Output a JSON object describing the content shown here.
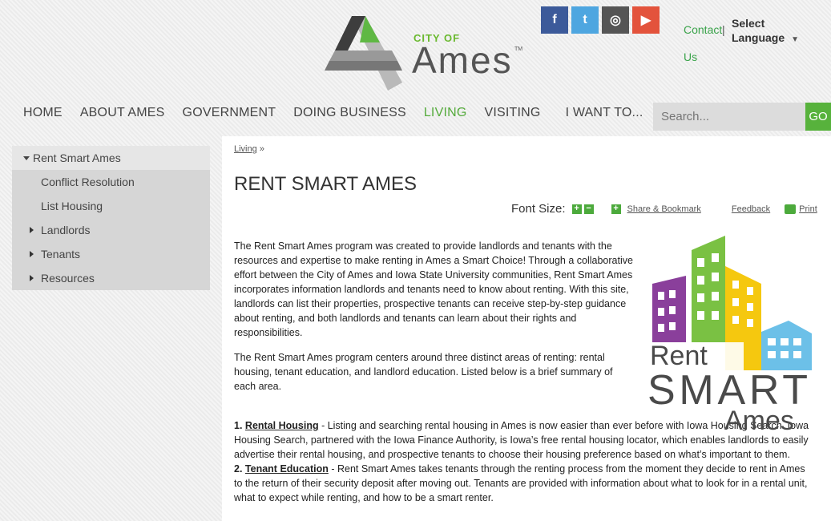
{
  "header": {
    "logo_city_of": "CITY OF",
    "logo_ames": "Ames",
    "logo_tm": "TM",
    "social": [
      {
        "icon": "facebook-icon",
        "glyph": "f",
        "color": "#3c5a9a"
      },
      {
        "icon": "twitter-icon",
        "glyph": "t",
        "color": "#4ea6e0"
      },
      {
        "icon": "instagram-icon",
        "glyph": "◎",
        "color": "#555555"
      },
      {
        "icon": "youtube-icon",
        "glyph": "▶",
        "color": "#e3533c"
      }
    ],
    "contact_label": "Contact Us",
    "contact_sep": "|",
    "language_label": "Select Language"
  },
  "nav": {
    "items": [
      "HOME",
      "ABOUT AMES",
      "GOVERNMENT",
      "DOING BUSINESS",
      "LIVING",
      "VISITING",
      "I WANT TO..."
    ],
    "active": "LIVING",
    "search_placeholder": "Search...",
    "go_label": "GO"
  },
  "sidebar": {
    "top": "Rent Smart Ames",
    "items": [
      {
        "label": "Conflict Resolution",
        "expandable": false
      },
      {
        "label": "List Housing",
        "expandable": false
      },
      {
        "label": "Landlords",
        "expandable": true
      },
      {
        "label": "Tenants",
        "expandable": true
      },
      {
        "label": "Resources",
        "expandable": true
      }
    ]
  },
  "main": {
    "breadcrumb": "Living",
    "breadcrumb_sep": "»",
    "title": "RENT SMART AMES",
    "font_size_label": "Font Size:",
    "share_label": "Share & Bookmark",
    "feedback_label": "Feedback",
    "print_label": "Print",
    "para1": "The Rent Smart Ames program was created to provide landlords and tenants with the resources and expertise to make renting in Ames a Smart Choice! Through a collaborative effort between the City of Ames and Iowa State University communities, Rent Smart Ames incorporates information landlords and tenants need to know about renting. With this site, landlords can list their properties, prospective tenants can receive step-by-step guidance about renting, and both landlords and tenants can learn about their rights and responsibilities.",
    "para2": "The Rent Smart Ames program centers around three distinct areas of renting: rental housing, tenant education, and landlord education. Listed below is a brief summary of each area.",
    "item1_num": "1.",
    "item1_title": "Rental Housing",
    "item1_text": " - Listing and searching rental housing in Ames is now easier than ever before with Iowa Housing Search. Iowa Housing Search, partnered with the Iowa Finance Authority, is Iowa’s free rental housing locator, which enables landlords to easily advertise their rental housing, and prospective tenants to choose their housing preference based on what’s important to them.",
    "item2_num": "2.",
    "item2_title": "Tenant Education",
    "item2_text": " - Rent Smart Ames takes tenants through the renting process from the moment they decide to rent in Ames to the return of their security deposit after moving out. Tenants are provided with information about what to look for in a rental unit, what to expect while renting, and how to be a smart renter.",
    "rsa_logo": {
      "line1": "Rent",
      "line2": "SMART",
      "line3": "Ames"
    }
  },
  "colors": {
    "green": "#55ab3c",
    "purple": "#8a3f9b",
    "lime": "#7ac143",
    "yellow": "#f5c80f",
    "blue": "#6cc0e8"
  }
}
